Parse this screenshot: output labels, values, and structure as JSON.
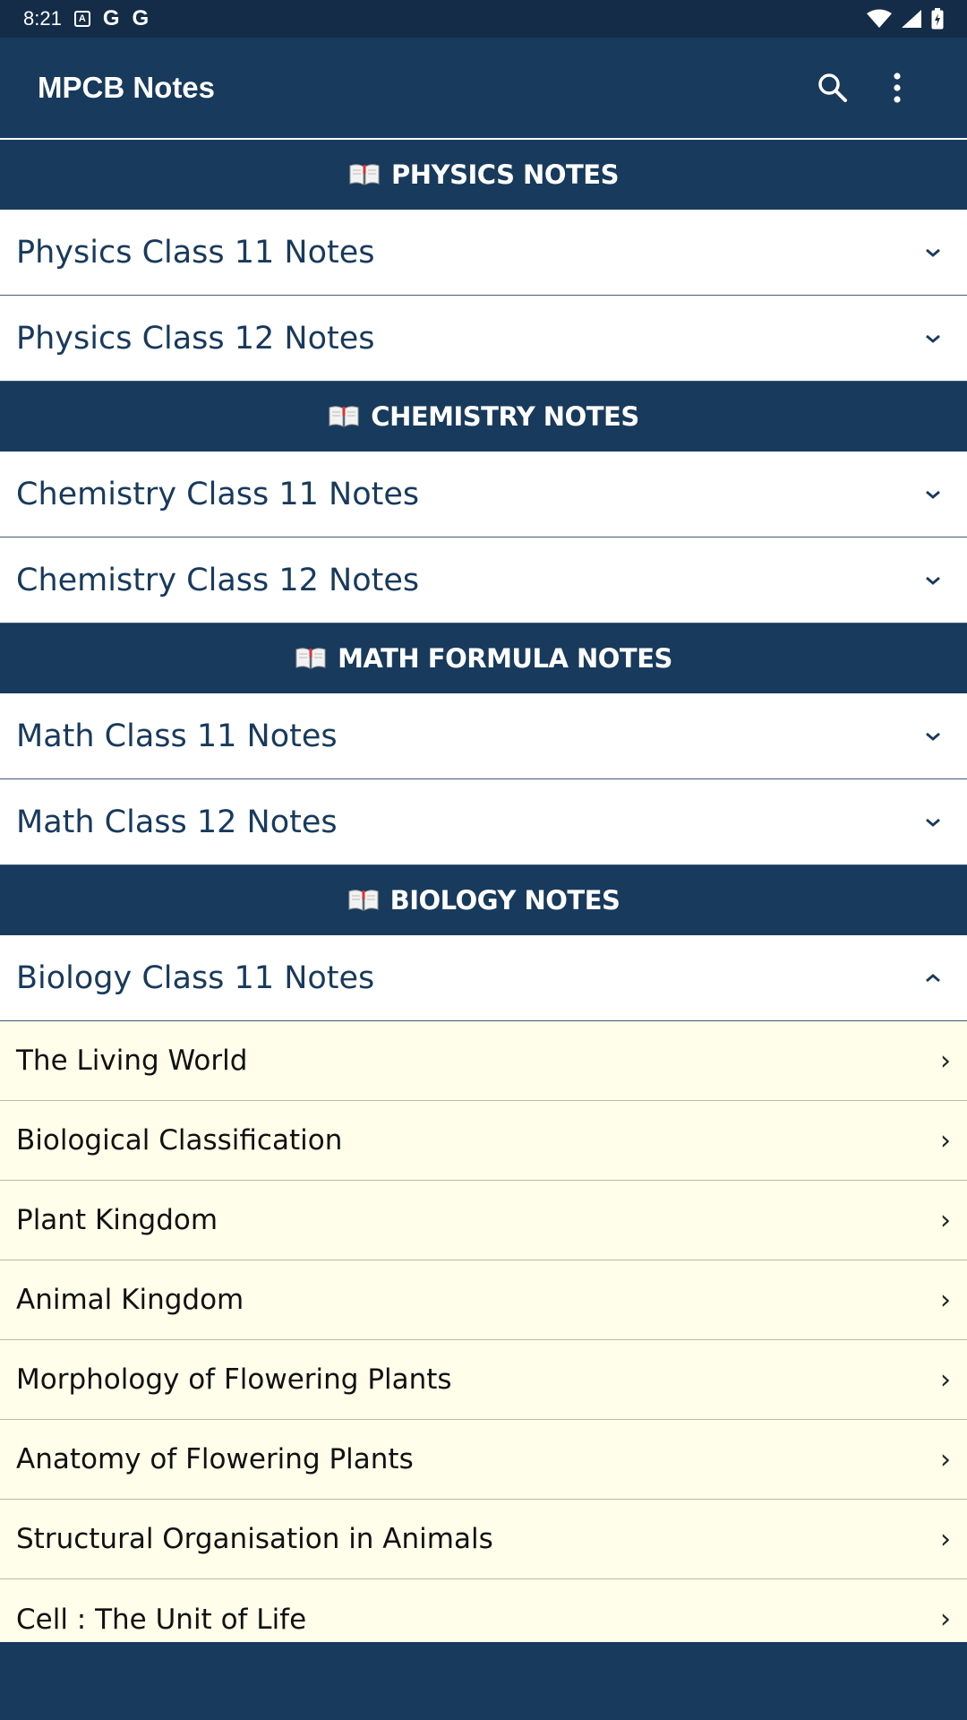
{
  "status_bar": {
    "time": "8:21",
    "notif_icons": [
      "text-a-icon",
      "google-g-icon",
      "google-g-icon"
    ],
    "glyph_g": "G"
  },
  "app_bar": {
    "title": "MPCB Notes",
    "icons": [
      "search-icon",
      "more-vert-icon"
    ]
  },
  "sections": [
    {
      "title": "PHYSICS NOTES",
      "items": [
        {
          "label": "Physics Class 11 Notes",
          "expanded": false
        },
        {
          "label": "Physics Class 12 Notes",
          "expanded": false
        }
      ]
    },
    {
      "title": "CHEMISTRY NOTES",
      "items": [
        {
          "label": "Chemistry Class 11 Notes",
          "expanded": false
        },
        {
          "label": "Chemistry Class 12 Notes",
          "expanded": false
        }
      ]
    },
    {
      "title": "MATH FORMULA NOTES",
      "items": [
        {
          "label": "Math Class 11 Notes",
          "expanded": false
        },
        {
          "label": "Math Class 12 Notes",
          "expanded": false
        }
      ]
    },
    {
      "title": "BIOLOGY NOTES",
      "items": [
        {
          "label": "Biology Class 11 Notes",
          "expanded": true
        }
      ]
    }
  ],
  "biology_class_11_chapters": [
    "The Living World",
    "Biological Classification",
    "Plant Kingdom",
    "Animal Kingdom",
    "Morphology of Flowering Plants",
    "Anatomy of Flowering Plants",
    "Structural Organisation in Animals",
    "Cell : The Unit of Life"
  ],
  "chapter_arrow": "›",
  "colors": {
    "primary": "#183a5c",
    "status": "#142c47",
    "child_bg": "#fefeea"
  }
}
